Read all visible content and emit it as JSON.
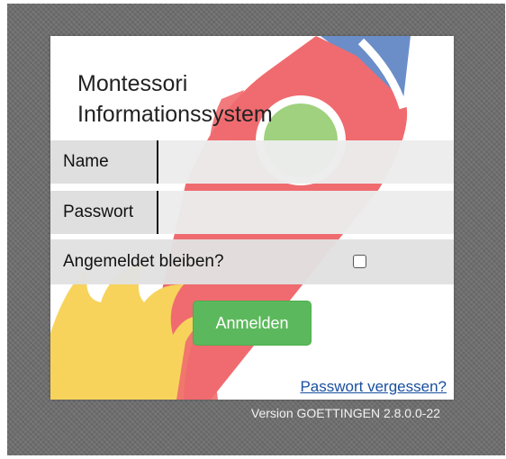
{
  "app": {
    "title_line1": "Montessori",
    "title_line2": "Informationssystem"
  },
  "login_form": {
    "name_label": "Name",
    "name_value": "",
    "password_label": "Passwort",
    "password_value": "",
    "remember_label": "Angemeldet bleiben?",
    "remember_checked": false,
    "submit_label": "Anmelden",
    "forgot_label": "Passwort vergessen?"
  },
  "footer": {
    "version_text": "Version GOETTINGEN 2.8.0.0-22"
  },
  "colors": {
    "background": "#6e6e6e",
    "submit_button": "#5cb85c",
    "link": "#1a4fa0",
    "rocket_red": "#ef6b6f",
    "rocket_blue": "#6b8ec9",
    "rocket_window": "#9fd17e",
    "rocket_flame": "#f7d35c"
  },
  "icons": {
    "background_illustration": "rocket-illustration"
  }
}
